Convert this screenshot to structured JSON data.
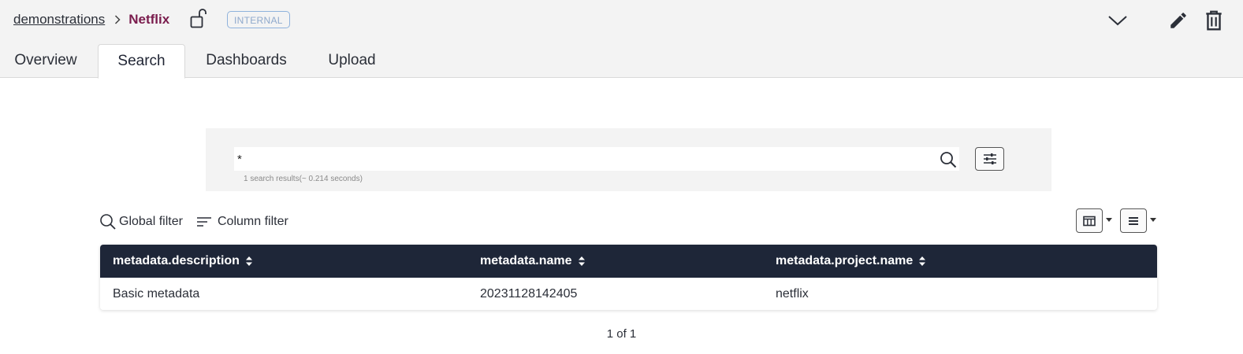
{
  "breadcrumb": {
    "parent": "demonstrations",
    "current": "Netflix"
  },
  "badge": "INTERNAL",
  "tabs": [
    {
      "label": "Overview",
      "active": false
    },
    {
      "label": "Search",
      "active": true
    },
    {
      "label": "Dashboards",
      "active": false
    },
    {
      "label": "Upload",
      "active": false
    }
  ],
  "search": {
    "query": "*",
    "results_text": "1 search results(~ 0.214 seconds)"
  },
  "filters": {
    "global": "Global filter",
    "column": "Column filter"
  },
  "table": {
    "columns": [
      "metadata.description",
      "metadata.name",
      "metadata.project.name"
    ],
    "rows": [
      [
        "Basic metadata",
        "20231128142405",
        "netflix"
      ]
    ]
  },
  "pagination": "1 of 1",
  "colors": {
    "header_bg": "#f3f3f3",
    "table_header_bg": "#1e2638",
    "breadcrumb_current": "#7a1c4d",
    "badge": "#8fb2dc"
  },
  "icons": [
    "unlock-icon",
    "chevron-down-icon",
    "pencil-icon",
    "trash-icon",
    "search-icon",
    "sliders-icon",
    "columns-icon",
    "list-icon",
    "sort-icon"
  ]
}
